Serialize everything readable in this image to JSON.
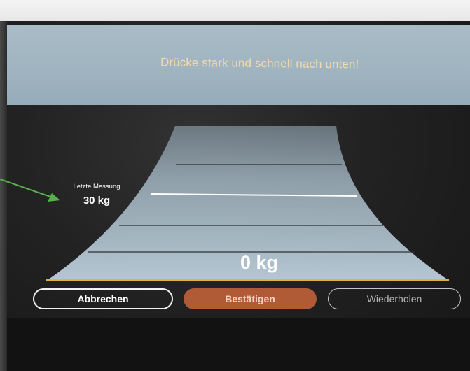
{
  "header": {
    "instruction": "Drücke stark und schnell nach unten!"
  },
  "gauge": {
    "last_measurement_label": "Letzte Messung",
    "last_measurement_value": "30 kg",
    "current_value": "0 kg",
    "accent_color": "#e2b23a",
    "fill_color": "#b9ccd8"
  },
  "buttons": {
    "cancel": "Abbrechen",
    "confirm": "Bestätigen",
    "repeat": "Wiederholen"
  },
  "colors": {
    "banner": "#a3b7c3",
    "instruction_text": "#f4d9b0",
    "confirm_button": "#b05a36",
    "annotation_arrow": "#55b24a"
  }
}
